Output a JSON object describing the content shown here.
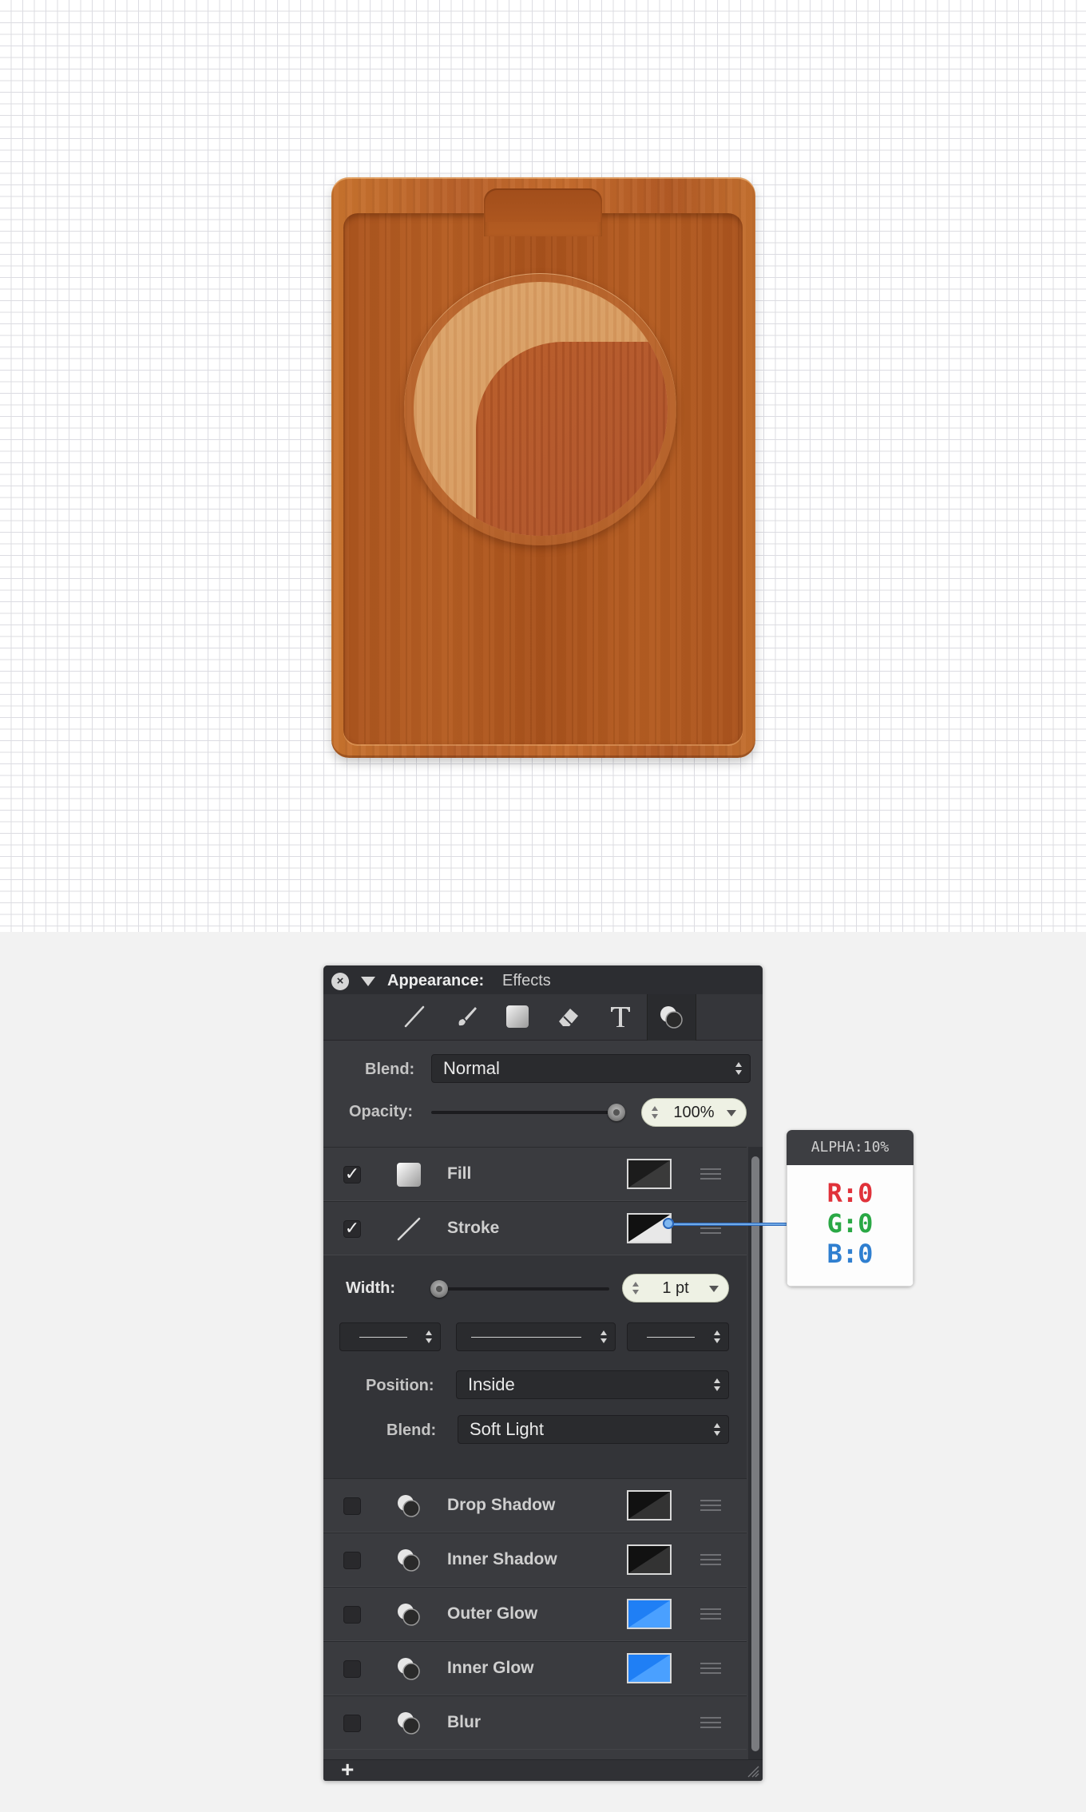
{
  "panel": {
    "title": "Appearance:",
    "subtitle": "Effects",
    "blend_label": "Blend:",
    "blend_value": "Normal",
    "opacity_label": "Opacity:",
    "opacity_value": "100%"
  },
  "layers": {
    "fill": {
      "label": "Fill",
      "checked": "✓"
    },
    "stroke": {
      "label": "Stroke",
      "checked": "✓"
    },
    "drop_shadow": {
      "label": "Drop Shadow"
    },
    "inner_shadow": {
      "label": "Inner Shadow"
    },
    "outer_glow": {
      "label": "Outer Glow"
    },
    "inner_glow": {
      "label": "Inner Glow"
    },
    "blur": {
      "label": "Blur"
    }
  },
  "stroke_options": {
    "width_label": "Width:",
    "width_value": "1 pt",
    "position_label": "Position:",
    "position_value": "Inside",
    "blend_label": "Blend:",
    "blend_value": "Soft Light"
  },
  "footer": {
    "add_label": "+"
  },
  "color_callout": {
    "alpha": "ALPHA:10%",
    "r": "R:0",
    "g": "G:0",
    "b": "B:0"
  },
  "colors": {
    "panel_bg": "#3a3b3f",
    "glow_blue": "#2f8cff",
    "wood": "#b55d22"
  },
  "icons": [
    "close-icon",
    "disclosure-triangle-icon",
    "line-tool-icon",
    "brush-tool-icon",
    "shape-tool-icon",
    "eraser-tool-icon",
    "text-tool-icon",
    "effects-tool-icon"
  ]
}
